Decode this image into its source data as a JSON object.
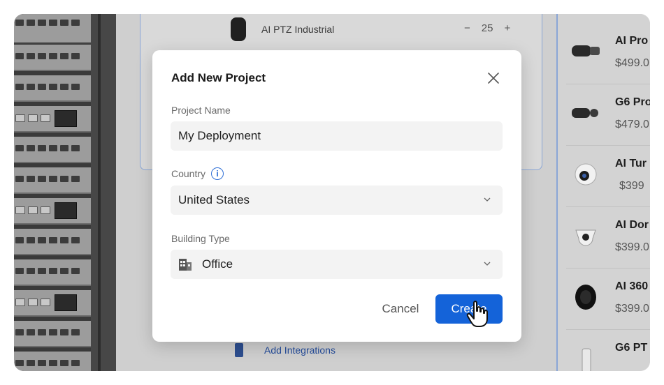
{
  "background": {
    "device_row": {
      "name": "AI PTZ Industrial",
      "quantity": "25",
      "minus": "−",
      "plus": "+"
    },
    "add_integrations": "Add Integrations"
  },
  "products": [
    {
      "name": "AI Pro",
      "price": "$499.0"
    },
    {
      "name": "G6 Pro",
      "price": "$479.0"
    },
    {
      "name": "AI Tur",
      "price": "$399"
    },
    {
      "name": "AI Dor",
      "price": "$399.0"
    },
    {
      "name": "AI 360",
      "price": "$399.0"
    },
    {
      "name": "G6 PT",
      "price": ""
    }
  ],
  "modal": {
    "title": "Add New Project",
    "project_name_label": "Project Name",
    "project_name_value": "My Deployment",
    "country_label": "Country",
    "country_info": "i",
    "country_value": "United States",
    "building_type_label": "Building Type",
    "building_type_value": "Office",
    "cancel_label": "Cancel",
    "create_label": "Create"
  },
  "icons": {
    "close": "close-icon",
    "info": "info-icon",
    "chevron": "chevron-down-icon",
    "building": "building-icon",
    "cursor": "hand-cursor-icon"
  },
  "colors": {
    "primary": "#1463d9",
    "overlay": "#d4d4d4",
    "accent_line": "#8aa6d6"
  }
}
